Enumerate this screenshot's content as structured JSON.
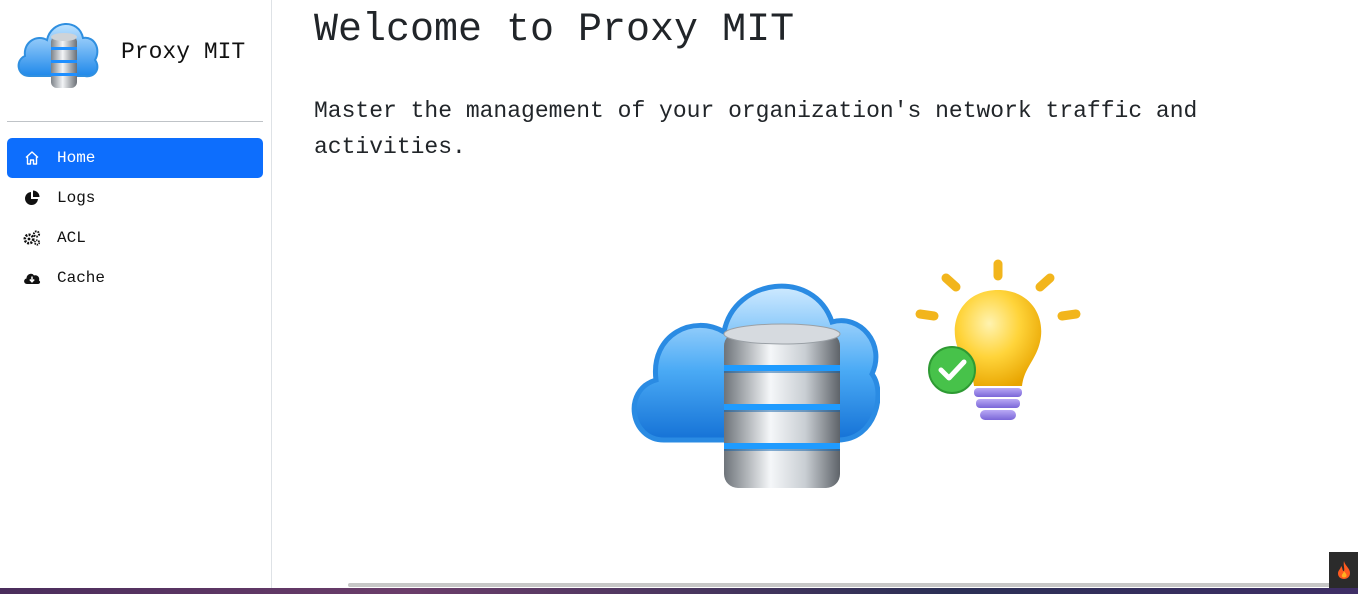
{
  "brand": {
    "title": "Proxy MIT",
    "logo_icon": "cloud-database-icon"
  },
  "sidebar": {
    "items": [
      {
        "label": "Home",
        "icon": "home-icon",
        "active": true
      },
      {
        "label": "Logs",
        "icon": "pie-chart-icon",
        "active": false
      },
      {
        "label": "ACL",
        "icon": "gears-icon",
        "active": false
      },
      {
        "label": "Cache",
        "icon": "cloud-download-icon",
        "active": false
      }
    ]
  },
  "main": {
    "title": "Welcome to Proxy MIT",
    "lead": "Master the management of your organization's network traffic and activities.",
    "illustrations": [
      "cloud-database-icon",
      "lightbulb-check-icon"
    ]
  },
  "colors": {
    "accent": "#0d6efd",
    "text": "#212529",
    "divider": "#dee2e6"
  }
}
